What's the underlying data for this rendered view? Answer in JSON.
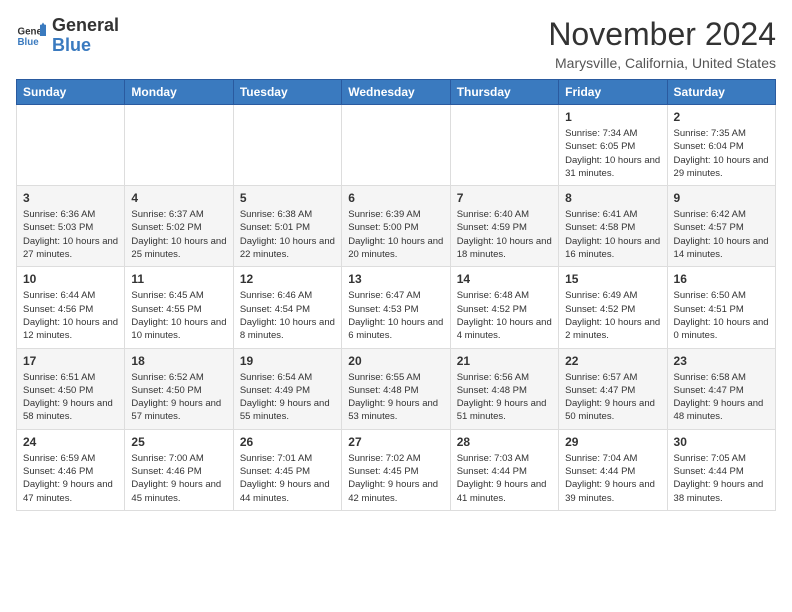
{
  "logo": {
    "general": "General",
    "blue": "Blue"
  },
  "header": {
    "month": "November 2024",
    "location": "Marysville, California, United States"
  },
  "days_of_week": [
    "Sunday",
    "Monday",
    "Tuesday",
    "Wednesday",
    "Thursday",
    "Friday",
    "Saturday"
  ],
  "weeks": [
    [
      {
        "day": "",
        "info": ""
      },
      {
        "day": "",
        "info": ""
      },
      {
        "day": "",
        "info": ""
      },
      {
        "day": "",
        "info": ""
      },
      {
        "day": "",
        "info": ""
      },
      {
        "day": "1",
        "info": "Sunrise: 7:34 AM\nSunset: 6:05 PM\nDaylight: 10 hours and 31 minutes."
      },
      {
        "day": "2",
        "info": "Sunrise: 7:35 AM\nSunset: 6:04 PM\nDaylight: 10 hours and 29 minutes."
      }
    ],
    [
      {
        "day": "3",
        "info": "Sunrise: 6:36 AM\nSunset: 5:03 PM\nDaylight: 10 hours and 27 minutes."
      },
      {
        "day": "4",
        "info": "Sunrise: 6:37 AM\nSunset: 5:02 PM\nDaylight: 10 hours and 25 minutes."
      },
      {
        "day": "5",
        "info": "Sunrise: 6:38 AM\nSunset: 5:01 PM\nDaylight: 10 hours and 22 minutes."
      },
      {
        "day": "6",
        "info": "Sunrise: 6:39 AM\nSunset: 5:00 PM\nDaylight: 10 hours and 20 minutes."
      },
      {
        "day": "7",
        "info": "Sunrise: 6:40 AM\nSunset: 4:59 PM\nDaylight: 10 hours and 18 minutes."
      },
      {
        "day": "8",
        "info": "Sunrise: 6:41 AM\nSunset: 4:58 PM\nDaylight: 10 hours and 16 minutes."
      },
      {
        "day": "9",
        "info": "Sunrise: 6:42 AM\nSunset: 4:57 PM\nDaylight: 10 hours and 14 minutes."
      }
    ],
    [
      {
        "day": "10",
        "info": "Sunrise: 6:44 AM\nSunset: 4:56 PM\nDaylight: 10 hours and 12 minutes."
      },
      {
        "day": "11",
        "info": "Sunrise: 6:45 AM\nSunset: 4:55 PM\nDaylight: 10 hours and 10 minutes."
      },
      {
        "day": "12",
        "info": "Sunrise: 6:46 AM\nSunset: 4:54 PM\nDaylight: 10 hours and 8 minutes."
      },
      {
        "day": "13",
        "info": "Sunrise: 6:47 AM\nSunset: 4:53 PM\nDaylight: 10 hours and 6 minutes."
      },
      {
        "day": "14",
        "info": "Sunrise: 6:48 AM\nSunset: 4:52 PM\nDaylight: 10 hours and 4 minutes."
      },
      {
        "day": "15",
        "info": "Sunrise: 6:49 AM\nSunset: 4:52 PM\nDaylight: 10 hours and 2 minutes."
      },
      {
        "day": "16",
        "info": "Sunrise: 6:50 AM\nSunset: 4:51 PM\nDaylight: 10 hours and 0 minutes."
      }
    ],
    [
      {
        "day": "17",
        "info": "Sunrise: 6:51 AM\nSunset: 4:50 PM\nDaylight: 9 hours and 58 minutes."
      },
      {
        "day": "18",
        "info": "Sunrise: 6:52 AM\nSunset: 4:50 PM\nDaylight: 9 hours and 57 minutes."
      },
      {
        "day": "19",
        "info": "Sunrise: 6:54 AM\nSunset: 4:49 PM\nDaylight: 9 hours and 55 minutes."
      },
      {
        "day": "20",
        "info": "Sunrise: 6:55 AM\nSunset: 4:48 PM\nDaylight: 9 hours and 53 minutes."
      },
      {
        "day": "21",
        "info": "Sunrise: 6:56 AM\nSunset: 4:48 PM\nDaylight: 9 hours and 51 minutes."
      },
      {
        "day": "22",
        "info": "Sunrise: 6:57 AM\nSunset: 4:47 PM\nDaylight: 9 hours and 50 minutes."
      },
      {
        "day": "23",
        "info": "Sunrise: 6:58 AM\nSunset: 4:47 PM\nDaylight: 9 hours and 48 minutes."
      }
    ],
    [
      {
        "day": "24",
        "info": "Sunrise: 6:59 AM\nSunset: 4:46 PM\nDaylight: 9 hours and 47 minutes."
      },
      {
        "day": "25",
        "info": "Sunrise: 7:00 AM\nSunset: 4:46 PM\nDaylight: 9 hours and 45 minutes."
      },
      {
        "day": "26",
        "info": "Sunrise: 7:01 AM\nSunset: 4:45 PM\nDaylight: 9 hours and 44 minutes."
      },
      {
        "day": "27",
        "info": "Sunrise: 7:02 AM\nSunset: 4:45 PM\nDaylight: 9 hours and 42 minutes."
      },
      {
        "day": "28",
        "info": "Sunrise: 7:03 AM\nSunset: 4:44 PM\nDaylight: 9 hours and 41 minutes."
      },
      {
        "day": "29",
        "info": "Sunrise: 7:04 AM\nSunset: 4:44 PM\nDaylight: 9 hours and 39 minutes."
      },
      {
        "day": "30",
        "info": "Sunrise: 7:05 AM\nSunset: 4:44 PM\nDaylight: 9 hours and 38 minutes."
      }
    ]
  ]
}
